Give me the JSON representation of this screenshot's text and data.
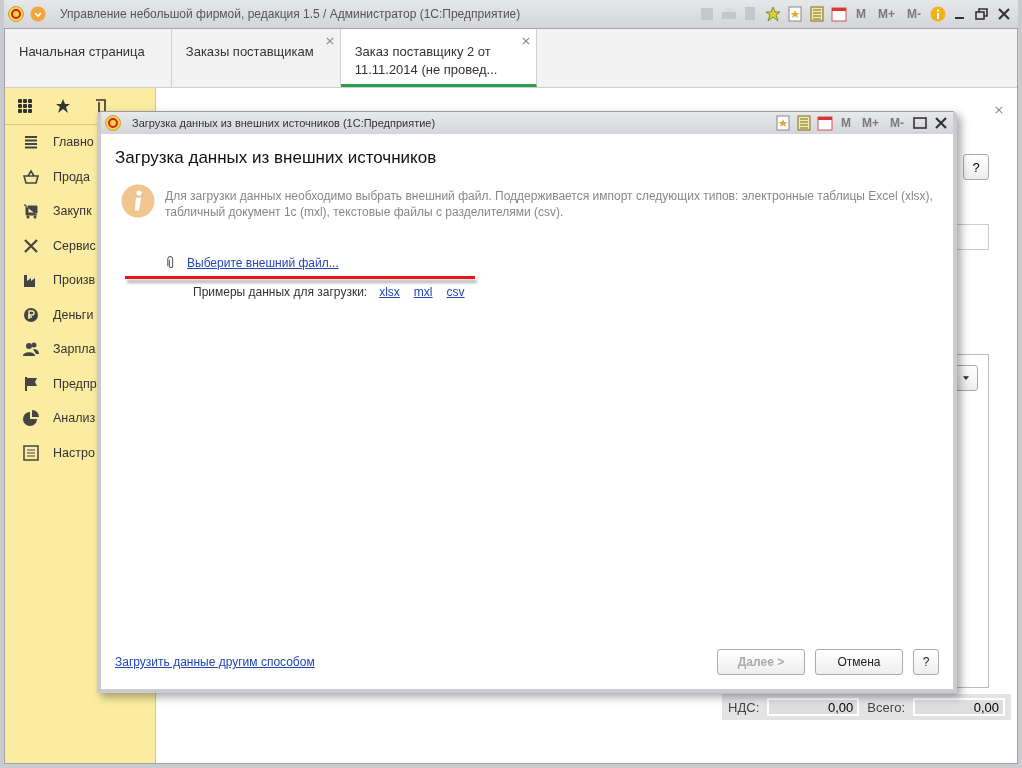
{
  "window": {
    "title": "Управление небольшой фирмой, редакция 1.5 / Администратор  (1С:Предприятие)",
    "toolbar_right": [
      "M",
      "M+",
      "M-"
    ]
  },
  "tabs": [
    {
      "label": "Начальная страница",
      "selected": false,
      "closable": false
    },
    {
      "label": "Заказы поставщикам",
      "selected": false,
      "closable": true
    },
    {
      "label": "Заказ поставщику 2 от 11.11.2014  (не провед...",
      "selected": true,
      "closable": true
    }
  ],
  "sidebar": {
    "items": [
      {
        "label": "Главно"
      },
      {
        "label": "Прода"
      },
      {
        "label": "Закупк"
      },
      {
        "label": "Сервис"
      },
      {
        "label": "Произв"
      },
      {
        "label": "Деньги"
      },
      {
        "label": "Зарпла"
      },
      {
        "label": "Предпр"
      },
      {
        "label": "Анализ"
      },
      {
        "label": "Настро"
      }
    ]
  },
  "document": {
    "help_button": "?",
    "totals": [
      {
        "label": "НДС:",
        "value": "0,00"
      },
      {
        "label": "Всего:",
        "value": "0,00"
      }
    ]
  },
  "dialog": {
    "title": "Загрузка данных из внешних источников  (1С:Предприятие)",
    "toolbar_right": [
      "M",
      "M+",
      "M-"
    ],
    "heading": "Загрузка данных из внешних источников",
    "info": "Для загрузки данных необходимо выбрать внешний файл. Поддерживается импорт следующих типов: электронные таблицы Excel (xlsx), табличный документ 1с (mxl), текстовые файлы с разделителями (csv).",
    "choose_file_link": "Выберите внешний файл...",
    "examples_label": "Примеры данных для загрузки:",
    "example_links": [
      "xlsx",
      "mxl",
      "csv"
    ],
    "other_way_link": "Загрузить данные другим способом",
    "buttons": [
      {
        "label": "Далее >",
        "disabled": true
      },
      {
        "label": "Отмена",
        "disabled": false
      },
      {
        "label": "?",
        "disabled": false
      }
    ]
  }
}
